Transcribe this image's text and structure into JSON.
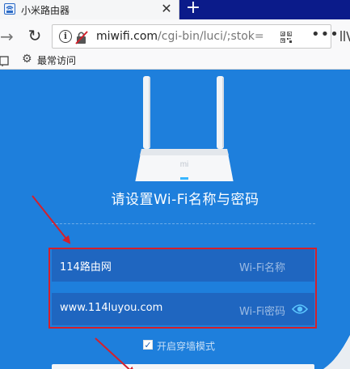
{
  "browser": {
    "tab": {
      "title": "小米路由器",
      "close_glyph": "✕"
    },
    "new_tab_glyph": "+",
    "nav": {
      "forward_glyph": "→",
      "reload_glyph": "↻"
    },
    "url": {
      "host": "miwifi.com",
      "path": "/cgi-bin/luci/;stok="
    },
    "more_glyph": "•••",
    "bookmarks": {
      "most_visited_label": "最常访问"
    }
  },
  "page": {
    "logo_text": "mi",
    "heading": "请设置Wi-Fi名称与密码",
    "ssid_field": {
      "value": "114路由网",
      "hint": "Wi-Fi名称"
    },
    "password_field": {
      "value": "www.114luyou.com",
      "hint": "Wi-Fi密码"
    },
    "wall_mode": {
      "checked": true,
      "check_glyph": "✓",
      "label": "开启穿墙模式"
    }
  },
  "colors": {
    "page_background": "#1e7fdc",
    "field_background": "#1f66c0",
    "annotation_red": "#d4202b",
    "tab_strip": "#0b1b8a"
  },
  "icons": {
    "favicon": "router-favicon-icon",
    "site_info": "info-icon",
    "insecure": "insecure-lock-icon",
    "qr": "qr-code-icon",
    "eye": "eye-icon",
    "settings": "gear-icon"
  }
}
